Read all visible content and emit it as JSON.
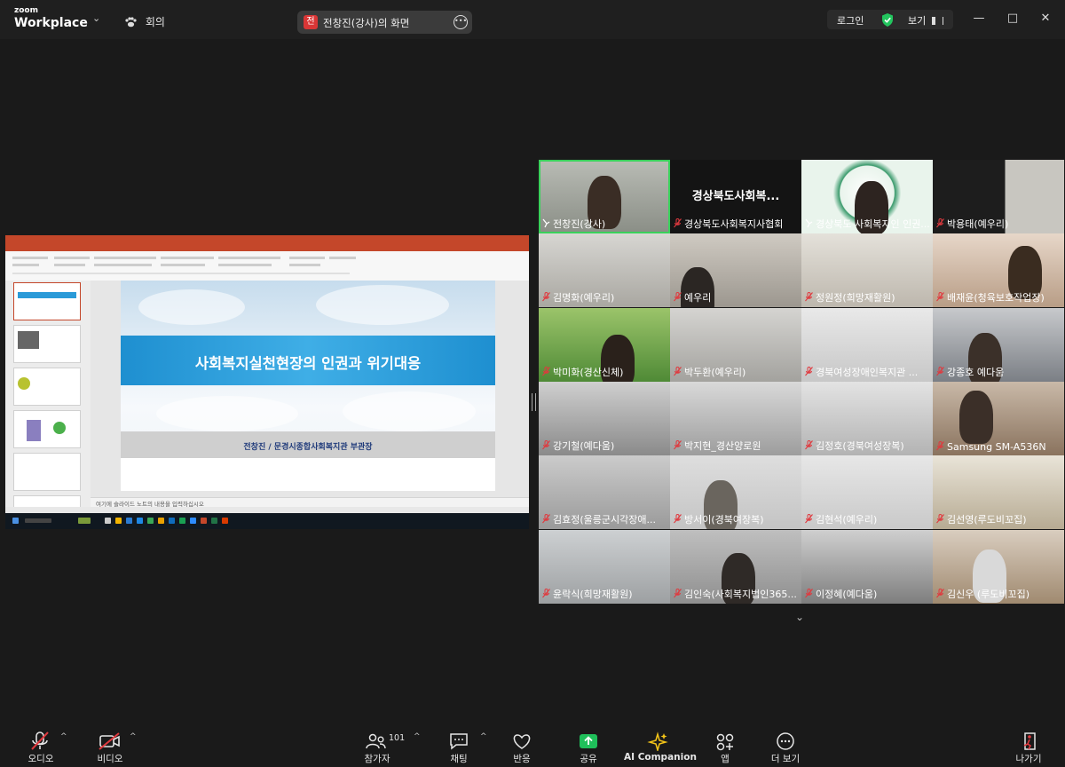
{
  "app": {
    "logo_top": "zoom",
    "logo_bottom": "Workplace",
    "meeting_label": "회의"
  },
  "share_indicator": {
    "badge": "전",
    "label": "전창진(강사)의 화면"
  },
  "top_right": {
    "login": "로그인",
    "view": "보기"
  },
  "shared_slide": {
    "title": "사회복지실천현장의 인권과 위기대응",
    "subtitle": "전창진 / 문경시종합사회복지관 부관장",
    "notes_placeholder": "여기에 슬라이드 노트의 내용을 입력하십시오"
  },
  "participants": [
    {
      "name": "전창진(강사)",
      "muted": false,
      "active": true
    },
    {
      "name": "경상북도사회복지사협회",
      "display": "경상북도사회복...",
      "muted": true
    },
    {
      "name": "경상북도 사회복지인 인권...",
      "muted": false
    },
    {
      "name": "박용태(예우리)",
      "muted": true
    },
    {
      "name": "김명화(예우리)",
      "muted": true
    },
    {
      "name": "예우리",
      "muted": true
    },
    {
      "name": "정원정(희망재활원)",
      "muted": true
    },
    {
      "name": "배재윤(청육보호작업장)",
      "muted": true
    },
    {
      "name": "박미화(경산신체)",
      "muted": true
    },
    {
      "name": "박두환(예우리)",
      "muted": true
    },
    {
      "name": "경북여성장애인복지관 ...",
      "muted": true
    },
    {
      "name": "강종호 예다움",
      "muted": true
    },
    {
      "name": "강기철(예다움)",
      "muted": true
    },
    {
      "name": "박지현_경산양로원",
      "muted": true
    },
    {
      "name": "김정호(경북여성장복)",
      "muted": true
    },
    {
      "name": "Samsung SM-A536N",
      "muted": true
    },
    {
      "name": "김효정(울릉군시각장애...",
      "muted": true
    },
    {
      "name": "방서이(경북여장복)",
      "muted": true
    },
    {
      "name": "김현석(예우리)",
      "muted": true
    },
    {
      "name": "김선영(루도비꼬집)",
      "muted": true
    },
    {
      "name": "윤락식(희망재활원)",
      "muted": true
    },
    {
      "name": "김인숙(사회복지법인365...",
      "muted": true
    },
    {
      "name": "이정혜(예다움)",
      "muted": true
    },
    {
      "name": "김신우 (루도비꼬집)",
      "muted": true
    }
  ],
  "toolbar": {
    "audio": "오디오",
    "video": "비디오",
    "participants": "참가자",
    "participant_count": "101",
    "chat": "채팅",
    "reactions": "반응",
    "share": "공유",
    "ai_companion": "AI Companion",
    "apps": "앱",
    "more": "더 보기",
    "leave": "나가기"
  },
  "colors": {
    "accent_green": "#3ad15b",
    "share_green": "#1fbf5a",
    "mute_red": "#e0393e",
    "ai_yellow": "#f5c518",
    "slide_blue": "#1e8fd0"
  }
}
